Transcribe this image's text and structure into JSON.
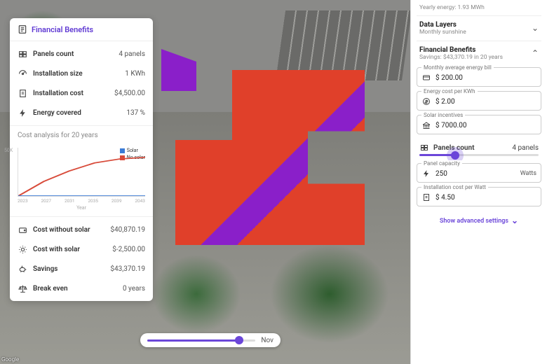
{
  "accent": "#6b46d9",
  "left_panel": {
    "header": "Financial Benefits",
    "metrics": [
      {
        "icon": "panels-icon",
        "label": "Panels count",
        "value": "4 panels"
      },
      {
        "icon": "gauge-icon",
        "label": "Installation size",
        "value": "1 KWh"
      },
      {
        "icon": "invoice-icon",
        "label": "Installation cost",
        "value": "$4,500.00"
      },
      {
        "icon": "bolt-icon",
        "label": "Energy covered",
        "value": "137 %"
      }
    ],
    "analysis_title": "Cost analysis for 20 years",
    "results": [
      {
        "icon": "wallet-icon",
        "label": "Cost without solar",
        "value": "$40,870.19"
      },
      {
        "icon": "sun-icon",
        "label": "Cost with solar",
        "value": "$-2,500.00"
      },
      {
        "icon": "piggy-icon",
        "label": "Savings",
        "value": "$43,370.19"
      },
      {
        "icon": "scale-icon",
        "label": "Break even",
        "value": "0 years"
      }
    ]
  },
  "chart_data": {
    "type": "line",
    "title": "",
    "xlabel": "Year",
    "ylabel": "",
    "ylim": [
      0,
      50
    ],
    "ytick_label": "50K",
    "x": [
      2023,
      2027,
      2031,
      2035,
      2039,
      2043
    ],
    "series": [
      {
        "name": "Solar",
        "color": "#3b7bd6",
        "values": [
          0,
          0,
          0,
          0,
          0,
          0
        ]
      },
      {
        "name": "No solar",
        "color": "#d84b3a",
        "values": [
          0,
          15,
          26,
          34,
          38,
          40
        ]
      }
    ]
  },
  "month_slider": {
    "value_label": "Nov",
    "position_pct": 85
  },
  "right_panel": {
    "yearly_energy_sub": "Yearly energy: 1.93 MWh",
    "data_layers": {
      "title": "Data Layers",
      "subtitle": "Monthly sunshine"
    },
    "financial": {
      "title": "Financial Benefits",
      "subtitle": "Savings: $43,370.19 in 20 years"
    },
    "fields": [
      {
        "legend": "Monthly average energy bill",
        "icon": "card-icon",
        "value": "$ 200.00"
      },
      {
        "legend": "Energy cost per KWh",
        "icon": "coin-icon",
        "value": "$ 2.00"
      },
      {
        "legend": "Solar incentives",
        "icon": "bank-icon",
        "value": "$ 7000.00"
      }
    ],
    "panels_slider": {
      "label": "Panels count",
      "value_label": "4 panels",
      "position_pct": 30
    },
    "fields2": [
      {
        "legend": "Panel capacity",
        "icon": "bolt-icon",
        "value": "250",
        "unit": "Watts"
      },
      {
        "legend": "Installation cost per Watt",
        "icon": "invoice-icon",
        "value": "$ 4.50"
      }
    ],
    "show_advanced": "Show advanced settings"
  },
  "attribution": "Google"
}
